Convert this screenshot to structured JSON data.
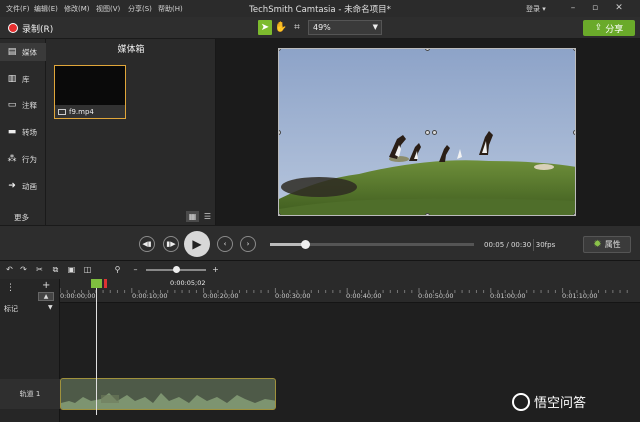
{
  "menubar": {
    "items": [
      "文件(F)",
      "编辑(E)",
      "修改(M)",
      "视图(V)",
      "分享(S)",
      "帮助(H)"
    ],
    "title": "TechSmith Camtasia - 未命名项目*",
    "login_label": "登录",
    "window_controls": [
      "minimize-icon",
      "maximize-icon",
      "close-icon"
    ]
  },
  "toolbar": {
    "record_label": "录制(R)",
    "tools": [
      "pointer-icon",
      "hand-icon",
      "crop-icon"
    ],
    "zoom_value": "49%",
    "share_label": "分享"
  },
  "left_nav": {
    "items": [
      {
        "label": "媒体",
        "icon": "media-icon"
      },
      {
        "label": "库",
        "icon": "library-icon"
      },
      {
        "label": "注释",
        "icon": "annotation-icon"
      },
      {
        "label": "转场",
        "icon": "transition-icon"
      },
      {
        "label": "行为",
        "icon": "behavior-icon"
      },
      {
        "label": "动画",
        "icon": "animation-icon"
      }
    ],
    "more_label": "更多",
    "add_label": "+"
  },
  "media_bin": {
    "title": "媒体箱",
    "file_name": "f9.mp4"
  },
  "playback": {
    "time": "00:05 / 00:30",
    "fps": "30fps",
    "properties_label": "属性",
    "progress": 0.17
  },
  "timeline": {
    "zoom_level": 0.5,
    "playhead_time": "0:00:05;02",
    "ticks": [
      "0:00:00;00",
      "0:00:10;00",
      "0:00:20;00",
      "0:00:30;00",
      "0:00:40;00",
      "0:00:50;00",
      "0:01:00;00",
      "0:01:10;00"
    ],
    "marker_label": "标记",
    "track_label": "轨道 1"
  },
  "watermark": {
    "text": "悟空问答"
  },
  "colors": {
    "accent_green": "#7dbb2e",
    "record_red": "#e62e2e",
    "clip_border": "#a0913c"
  }
}
